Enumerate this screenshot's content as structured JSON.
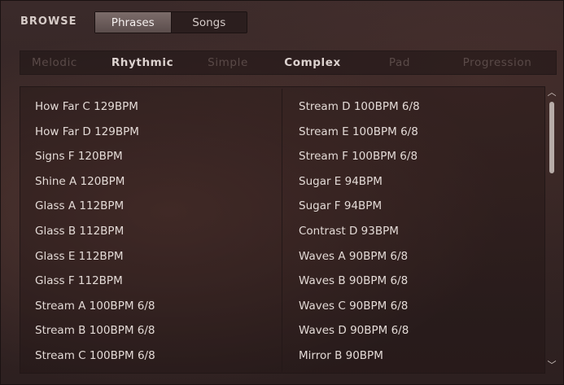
{
  "header": {
    "title": "BROWSE",
    "modes": [
      "Phrases",
      "Songs"
    ],
    "active_mode": "Phrases"
  },
  "filters": [
    {
      "label": "Melodic",
      "active": false
    },
    {
      "label": "Rhythmic",
      "active": true
    },
    {
      "label": "Simple",
      "active": false
    },
    {
      "label": "Complex",
      "active": true
    },
    {
      "label": "Pad",
      "active": false
    },
    {
      "label": "Progression",
      "active": false
    }
  ],
  "list": {
    "left": [
      "How Far C 129BPM",
      "How Far D 129BPM",
      "Signs F 120BPM",
      "Shine A 120BPM",
      "Glass A 112BPM",
      "Glass B 112BPM",
      "Glass E 112BPM",
      "Glass F 112BPM",
      "Stream A 100BPM 6/8",
      "Stream B 100BPM 6/8",
      "Stream C 100BPM 6/8"
    ],
    "right": [
      "Stream D 100BPM 6/8",
      "Stream E 100BPM 6/8",
      "Stream F 100BPM 6/8",
      "Sugar E 94BPM",
      "Sugar F 94BPM",
      "Contrast D 93BPM",
      "Waves A 90BPM 6/8",
      "Waves B 90BPM 6/8",
      "Waves C 90BPM 6/8",
      "Waves D 90BPM 6/8",
      "Mirror B 90BPM"
    ]
  },
  "scrollbar": {
    "up_icon": "chevron-up-icon",
    "down_icon": "chevron-down-icon"
  },
  "colors": {
    "background": "#352524",
    "text": "#e3dad6",
    "inactive_filter": "#5a4a48",
    "active_button": "#6b5c5a"
  }
}
